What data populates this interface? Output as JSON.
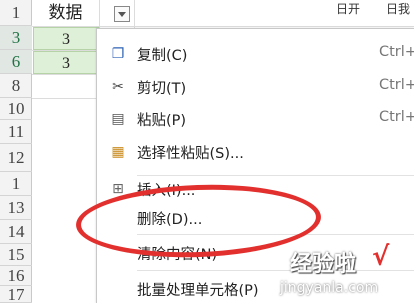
{
  "sheet": {
    "column_header": "数据",
    "top_right_partial": [
      "日开",
      "日我"
    ],
    "row_numbers": [
      "1",
      "3",
      "6",
      "8",
      "10",
      "11",
      "12",
      "1",
      "13",
      "14",
      "15",
      "16",
      "17"
    ],
    "selected_rows": [
      "3",
      "6"
    ],
    "cells": [
      "3",
      "3"
    ]
  },
  "context_menu": {
    "items": [
      {
        "icon": "copy-icon",
        "label": "复制(C)",
        "shortcut": "Ctrl+"
      },
      {
        "icon": "scissors-icon",
        "label": "剪切(T)",
        "shortcut": "Ctrl+"
      },
      {
        "icon": "paste-icon",
        "label": "粘贴(P)",
        "shortcut": "Ctrl+"
      },
      {
        "icon": "paste-special-icon",
        "label": "选择性粘贴(S)...",
        "shortcut": ""
      },
      {
        "icon": "insert-icon",
        "label": "插入(I)...",
        "shortcut": ""
      },
      {
        "icon": "",
        "label": "删除(D)...",
        "shortcut": ""
      },
      {
        "icon": "",
        "label": "清除内容(N)",
        "shortcut": ""
      },
      {
        "icon": "",
        "label": "批量处理单元格(P)",
        "shortcut": ""
      }
    ]
  },
  "annotation": {
    "color": "#e2302e"
  },
  "watermark": {
    "title": "经验啦",
    "check": "√",
    "url": "jingyanla.com"
  }
}
